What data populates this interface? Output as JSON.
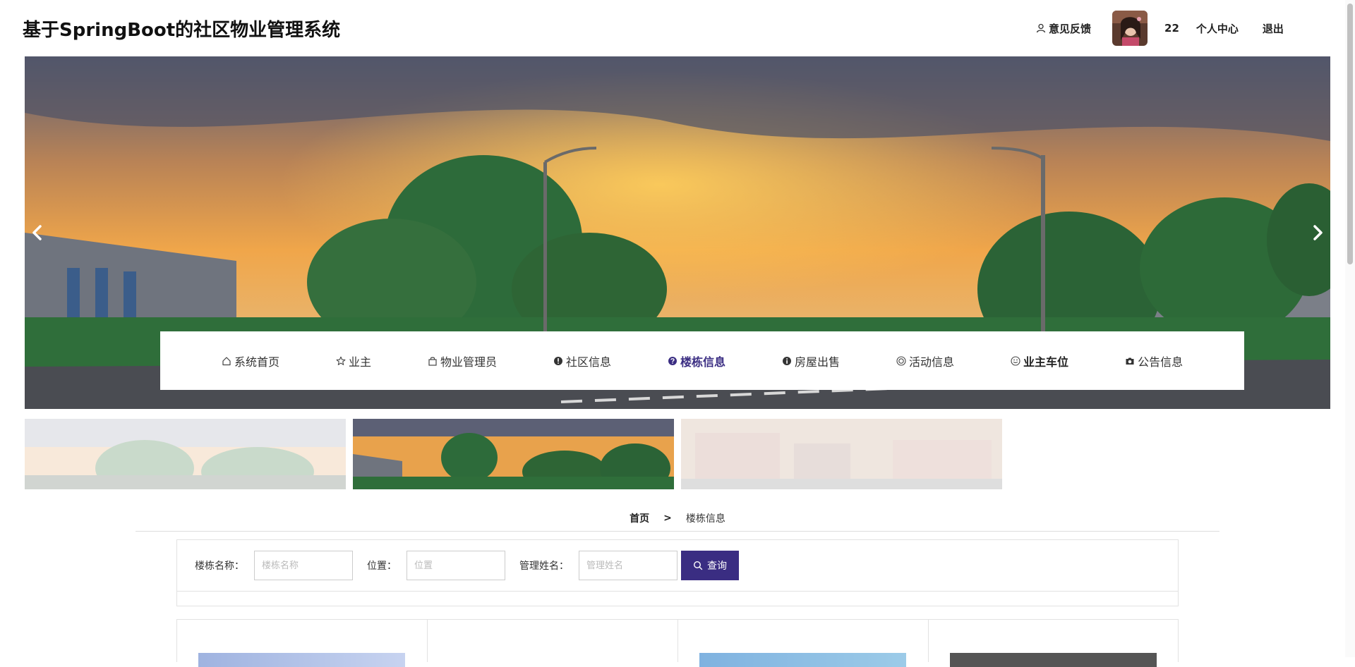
{
  "header": {
    "title": "基于SpringBoot的社区物业管理系统",
    "feedback": "意见反馈",
    "user_id": "22",
    "user_center": "个人中心",
    "logout": "退出"
  },
  "nav": {
    "items": [
      {
        "label": "系统首页",
        "icon": "home-icon"
      },
      {
        "label": "业主",
        "icon": "star-icon"
      },
      {
        "label": "物业管理员",
        "icon": "bag-icon"
      },
      {
        "label": "社区信息",
        "icon": "exclamation-circle-icon"
      },
      {
        "label": "楼栋信息",
        "icon": "question-circle-icon"
      },
      {
        "label": "房屋出售",
        "icon": "info-circle-icon"
      },
      {
        "label": "活动信息",
        "icon": "target-circle-icon"
      },
      {
        "label": "业主车位",
        "icon": "smile-circle-icon"
      },
      {
        "label": "公告信息",
        "icon": "camera-icon"
      }
    ],
    "active_index": 4,
    "hover_index": 7
  },
  "breadcrumb": {
    "home": "首页",
    "separator": ">",
    "current": "楼栋信息"
  },
  "search": {
    "fields": [
      {
        "label": "楼栋名称：",
        "placeholder": "楼栋名称",
        "value": ""
      },
      {
        "label": "位置：",
        "placeholder": "位置",
        "value": ""
      },
      {
        "label": "管理姓名：",
        "placeholder": "管理姓名",
        "value": ""
      }
    ],
    "button_label": "查询"
  },
  "colors": {
    "accent": "#3a2d82"
  }
}
